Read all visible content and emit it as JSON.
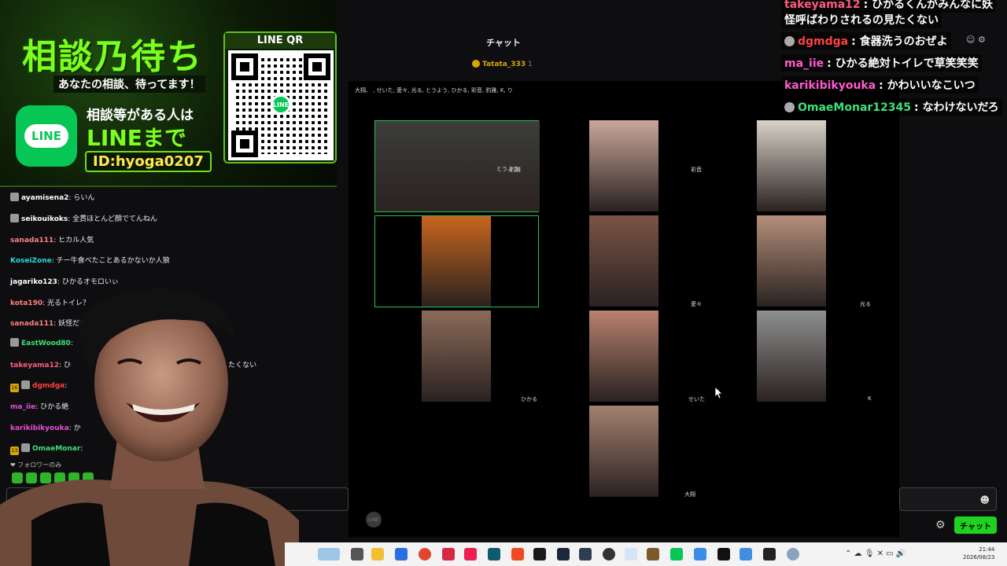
{
  "banner": {
    "title": "相談乃待ち",
    "subtitle": "あなたの相談、待ってます！",
    "line_icon": "LINE",
    "line_text": "相談等がある人は",
    "line_big": "LINEまで",
    "line_id": "ID:hyoga0207",
    "qr_label": "LINE QR",
    "qr_logo": "LINE"
  },
  "chat": {
    "header": "チャット",
    "gifter": "Tatata_333",
    "gifter_count": "1",
    "followers_only": "❤ フォロワーのみ",
    "messages": [
      {
        "user": "ayamisena2",
        "text": "らいん",
        "color": "#ffffff",
        "badge": true
      },
      {
        "user": "seikouikoks",
        "text": "全貫ほとんど顔でてんねん",
        "color": "#ffffff",
        "badge": true
      },
      {
        "user": "sanada111",
        "text": "ヒカル人気",
        "color": "#ff7f7f",
        "badge": false
      },
      {
        "user": "KoseiZone",
        "text": "チー牛食べたことあるかないか人狼",
        "color": "#2ed6d6",
        "badge": false
      },
      {
        "user": "jagariko123",
        "text": "ひかるオモロいぃ",
        "color": "#ffffff",
        "badge": false
      },
      {
        "user": "kota190",
        "text": "光るトイレ？",
        "color": "#ff7f7f",
        "badge": false
      },
      {
        "user": "sanada111",
        "text": "妖怪だぁ！",
        "color": "#ff7f7f",
        "badge": false
      },
      {
        "user": "EastWood80",
        "text": "",
        "color": "#3ee07a",
        "badge": true
      },
      {
        "user": "takeyama12",
        "text": "ひ",
        "color": "#ff5a7a",
        "badge": false,
        "tail": "たくない"
      },
      {
        "user": "dgmdga",
        "text": "",
        "color": "#ff4040",
        "badge": true,
        "sub": "16"
      },
      {
        "user": "ma_iie",
        "text": "ひかる絶",
        "color": "#e64fd9",
        "badge": false
      },
      {
        "user": "karikibikyouka",
        "text": "か",
        "color": "#e64fd9",
        "badge": false
      },
      {
        "user": "OmaeMonar",
        "text": "",
        "color": "#3ee07a",
        "badge": true,
        "sub": "13"
      }
    ],
    "send_button": "チャット",
    "emoji_icon": "☻"
  },
  "call": {
    "participants": "大翔、 , せいた, 愛々, 光る, とうよう, ひかる, 彩音, 豹雅, K, り",
    "tiles": [
      {
        "name": "豹雅",
        "active": true
      },
      {
        "name": "彩音",
        "active": false
      },
      {
        "name": "",
        "active": false
      },
      {
        "name": "とうよう",
        "active": true
      },
      {
        "name": "愛々",
        "active": false
      },
      {
        "name": "光る",
        "active": false
      },
      {
        "name": "ひかる",
        "active": false
      },
      {
        "name": "せいた",
        "active": false
      },
      {
        "name": "K",
        "active": false
      },
      {
        "name": "大翔",
        "active": false
      }
    ],
    "line_watermark": "LINE"
  },
  "overlay": {
    "messages": [
      {
        "user": "takeyama12",
        "text": "ひかるくんがみんなに妖",
        "color": "#ff5a7a",
        "avatar": false
      },
      {
        "user": "",
        "text": "怪呼ばわりされるの見たくない",
        "color": "#ffffff",
        "avatar": false
      },
      {
        "user": "dgmdga",
        "text": "食器洗うのおぜよ",
        "color": "#ff4040",
        "avatar": true
      },
      {
        "user": "ma_iie",
        "text": "ひかる絶対トイレで草笑笑笑",
        "color": "#ff5acd",
        "avatar": false
      },
      {
        "user": "karikibikyouka",
        "text": "かわいいなこいつ",
        "color": "#ff5acd",
        "avatar": false
      },
      {
        "user": "OmaeMonar12345",
        "text": "なわけないだろ",
        "color": "#3ee07a",
        "avatar": true
      }
    ]
  },
  "taskbar": {
    "time": "21:44",
    "date": "2026/08/23"
  },
  "colors": {
    "accent_green": "#1fd21f",
    "line_green": "#06c755",
    "active_tile_border": "#29c254"
  }
}
